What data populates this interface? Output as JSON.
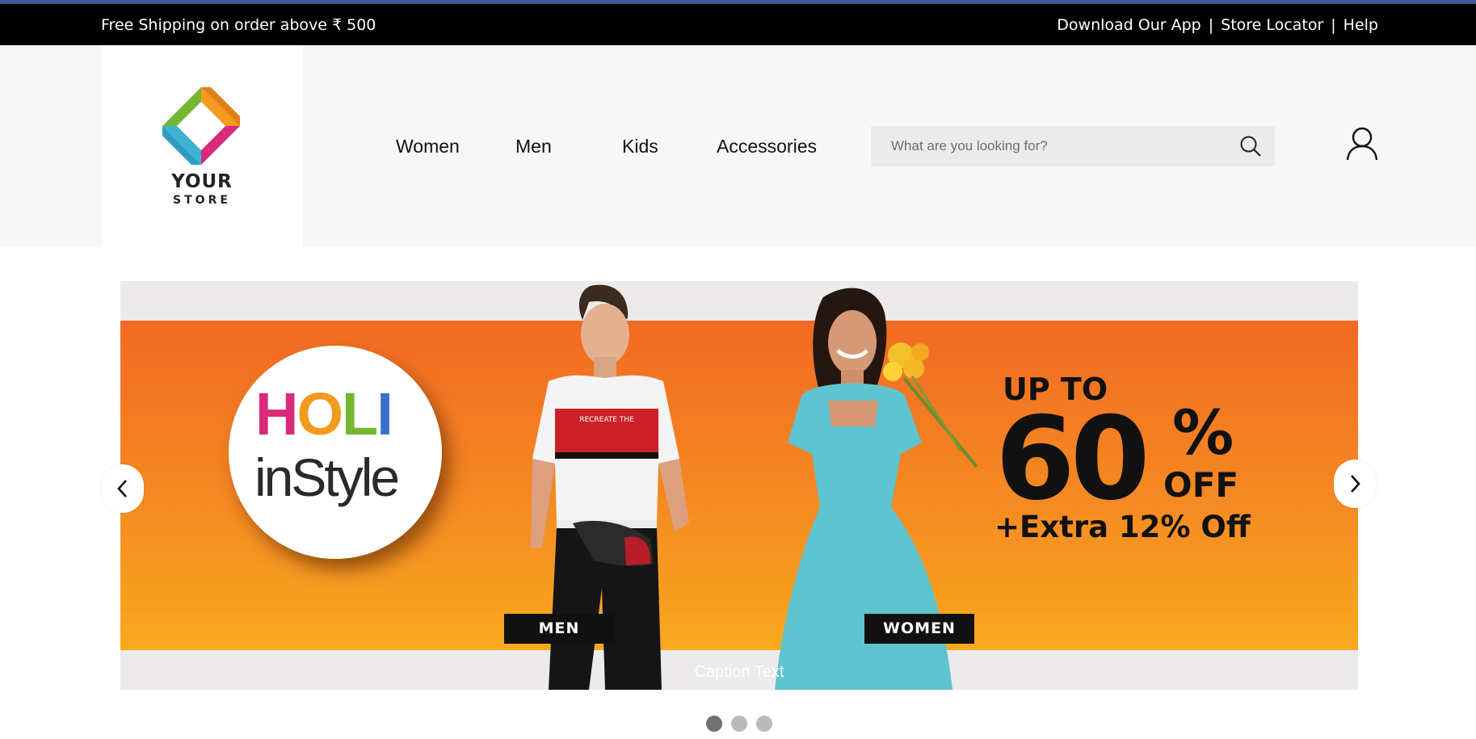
{
  "topbar": {
    "promo": "Free Shipping on order above ₹ 500",
    "links": [
      "Download Our App",
      "|",
      "Store Locator",
      "|",
      "Help"
    ]
  },
  "logo": {
    "line1": "YOUR",
    "line2": "STORE"
  },
  "nav": {
    "items": [
      "Women",
      "Men",
      "Kids",
      "Accessories"
    ]
  },
  "search": {
    "placeholder": "What are you looking for?",
    "value": "",
    "icon": "search-icon"
  },
  "account": {
    "icon": "user-icon"
  },
  "carousel": {
    "slide": {
      "holi_letters": [
        "H",
        "O",
        "L",
        "I"
      ],
      "instyle": "inStyle",
      "up_to": "UP TO",
      "discount": "60",
      "percent": "%",
      "off": "OFF",
      "extra": "+Extra 12% Off",
      "tag_men": "MEN",
      "tag_women": "WOMEN",
      "shirt_text": "RECREATE THE"
    },
    "caption": "Caption Text",
    "prev_icon": "chevron-left-icon",
    "next_icon": "chevron-right-icon",
    "slide_count": 3,
    "active_index": 0
  },
  "colors": {
    "topbar_bg": "#000000",
    "accent_line": "#3b5a9a",
    "header_bg": "#f7f7f7",
    "banner_orange": "#f26a23",
    "holi_pink": "#d92a7c",
    "holi_orange": "#f39a1f",
    "holi_green": "#73b730",
    "holi_blue": "#3a70c7"
  }
}
